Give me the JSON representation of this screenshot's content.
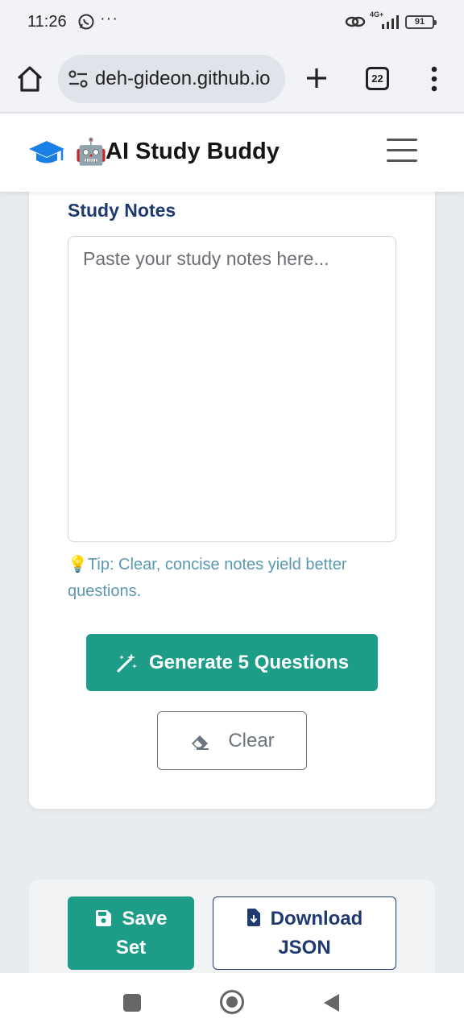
{
  "status_bar": {
    "time": "11:26",
    "dots": "···",
    "network": "4G+",
    "battery": "91"
  },
  "browser": {
    "url": "deh-gideon.github.io",
    "tab_count": "22"
  },
  "header": {
    "robot_emoji": "🤖",
    "title": "AI Study Buddy",
    "accent_color": "#1a7fe6"
  },
  "form": {
    "notes_label": "Study Notes",
    "notes_placeholder": "Paste your study notes here...",
    "notes_value": "",
    "tip": "💡Tip: Clear, concise notes yield better questions.",
    "generate_label": "Generate 5 Questions",
    "clear_label": "Clear"
  },
  "actions": {
    "save_line1": "Save",
    "save_line2": "Set",
    "download_line1": "Download",
    "download_line2": "JSON"
  },
  "colors": {
    "primary": "#1d9c87",
    "navy": "#1e3a70",
    "tip": "#5b98b0"
  }
}
